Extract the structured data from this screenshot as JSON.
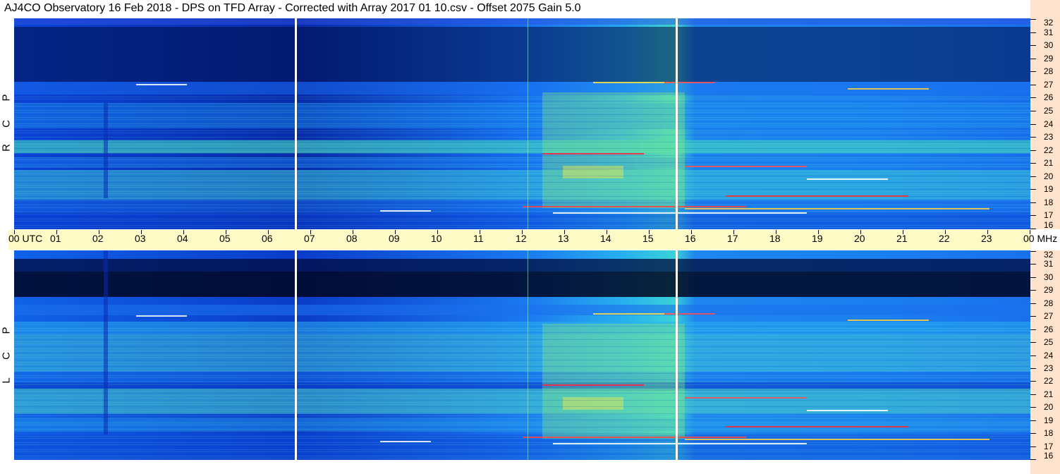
{
  "title": "AJ4CO Observatory  16 Feb 2018  -  DPS on TFD Array  -  Corrected with Array 2017 01 10.csv  -  Offset 2075  Gain 5.0",
  "rcp_label": [
    "R",
    "C",
    "P"
  ],
  "lcp_label": [
    "L",
    "C",
    "P"
  ],
  "time_axis": {
    "labels": [
      "00  UTC",
      "01",
      "02",
      "03",
      "04",
      "05",
      "06",
      "07",
      "08",
      "09",
      "10",
      "11",
      "12",
      "13",
      "14",
      "15",
      "16",
      "17",
      "18",
      "19",
      "20",
      "21",
      "22",
      "23",
      "00 MHz"
    ]
  },
  "freq_axis": {
    "labels": [
      "32",
      "31",
      "30",
      "29",
      "28",
      "27",
      "26",
      "25",
      "24",
      "23",
      "22",
      "21",
      "20",
      "19",
      "18",
      "17",
      "16"
    ]
  },
  "colors": {
    "time_axis_bg": "#fffbc7",
    "freq_axis_bg": "#ffe3cc",
    "spectrum_dark": "#000a3c",
    "spectrum_blue": "#0a4cff",
    "spectrum_cyan": "#24c6e8",
    "spectrum_green": "#8ef070",
    "spectrum_yellow": "#ffee40"
  }
}
